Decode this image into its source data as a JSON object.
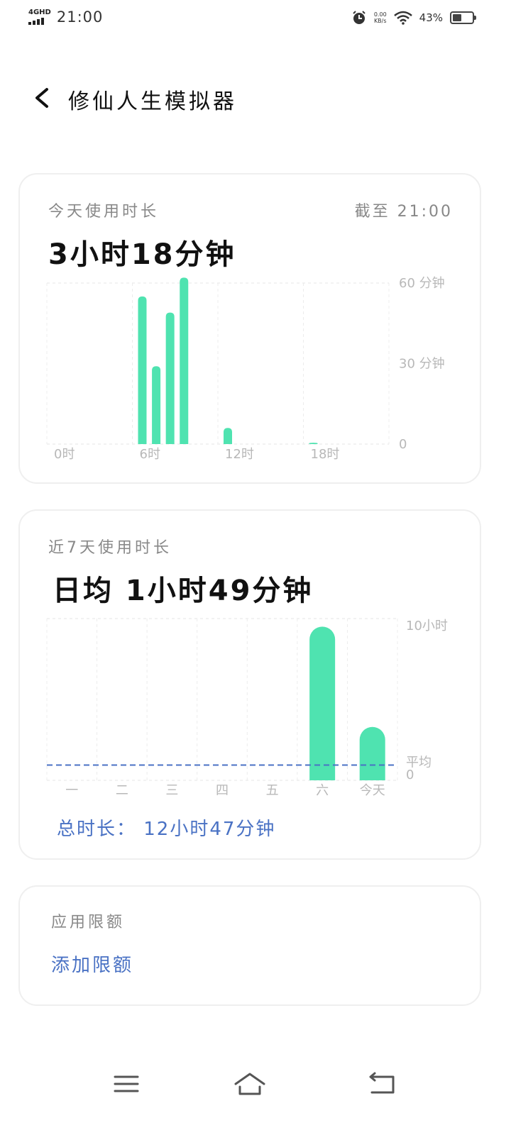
{
  "status_bar": {
    "network": "4GHD",
    "time": "21:00",
    "speed_value": "0.00",
    "speed_unit": "KB/s",
    "battery_percent": "43%"
  },
  "header": {
    "title": "修仙人生模拟器"
  },
  "today": {
    "label": "今天使用时长",
    "as_of": "截至 21:00",
    "total": "3小时18分钟"
  },
  "week": {
    "label": "近7天使用时长",
    "average": "日均 1小时49分钟",
    "total": "总时长： 12小时47分钟"
  },
  "limits": {
    "label": "应用限额",
    "add_label": "添加限额"
  },
  "colors": {
    "bar": "#4fe3b0",
    "accent": "#4a72c4",
    "average_line": "#4a72c4"
  },
  "chart_data": [
    {
      "type": "bar",
      "x_unit": "hour",
      "x": [
        6,
        7,
        8,
        9,
        12,
        18
      ],
      "values": [
        55,
        29,
        49,
        62,
        6,
        0.5
      ],
      "xticklabels": [
        "0时",
        "6时",
        "12时",
        "18时"
      ],
      "yticklabels": [
        "60 分钟",
        "30 分钟",
        "0"
      ],
      "ylim": [
        0,
        60
      ]
    },
    {
      "type": "bar",
      "categories": [
        "一",
        "二",
        "三",
        "四",
        "五",
        "六",
        "今天"
      ],
      "values": [
        0,
        0,
        0,
        0,
        0,
        9.5,
        3.3
      ],
      "average": 1.82,
      "yticklabels": [
        "10小时",
        "平均",
        "0"
      ],
      "ylim": [
        0,
        10
      ]
    }
  ]
}
